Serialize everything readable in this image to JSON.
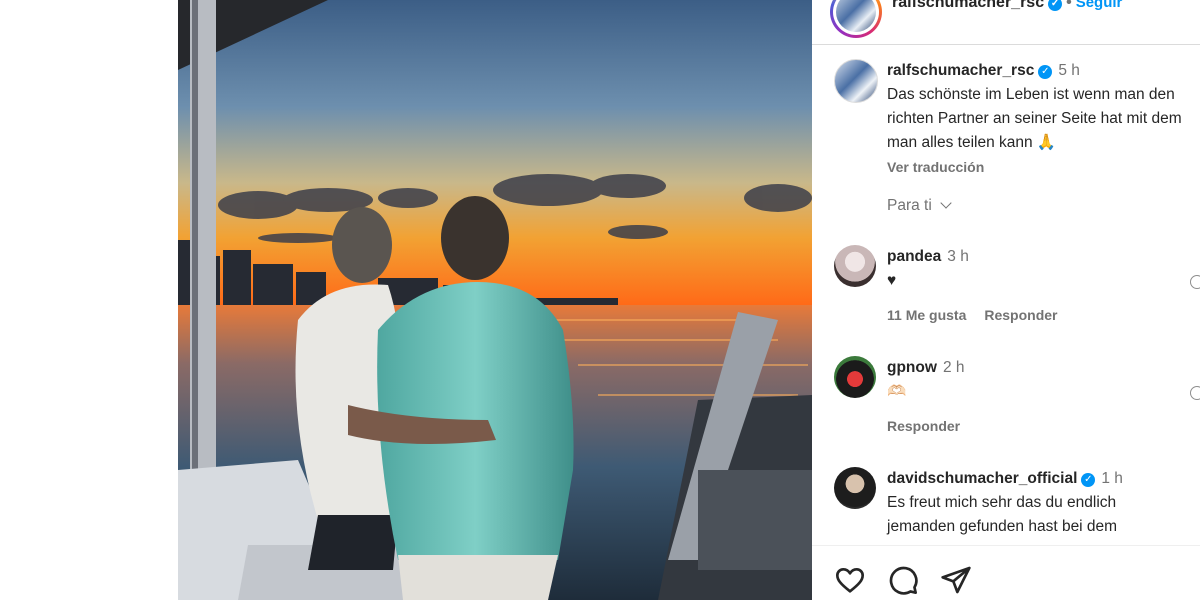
{
  "header": {
    "username": "ralfschumacher_rsc",
    "separator": "•",
    "follow_label": "Seguir"
  },
  "caption": {
    "username": "ralfschumacher_rsc",
    "time": "5 h",
    "text": "Das schönste im Leben ist wenn man den richten Partner an seiner Seite hat mit dem man alles teilen kann 🙏",
    "translate_label": "Ver traducción",
    "for_you_label": "Para ti"
  },
  "comments": [
    {
      "username": "pandea",
      "time": "3 h",
      "text": "♥",
      "likes": "11 Me gusta",
      "reply_label": "Responder"
    },
    {
      "username": "gpnow",
      "time": "2 h",
      "text": "🫶🏻",
      "reply_label": "Responder"
    },
    {
      "username": "davidschumacher_official",
      "time": "1 h",
      "text": "Es freut mich sehr das du endlich jemanden gefunden hast bei dem"
    }
  ],
  "actions": {
    "like": "heart-icon",
    "comment": "comment-icon",
    "share": "share-icon"
  },
  "colors": {
    "link": "#0095f6",
    "verified": "#0095f6",
    "muted": "#737373"
  }
}
